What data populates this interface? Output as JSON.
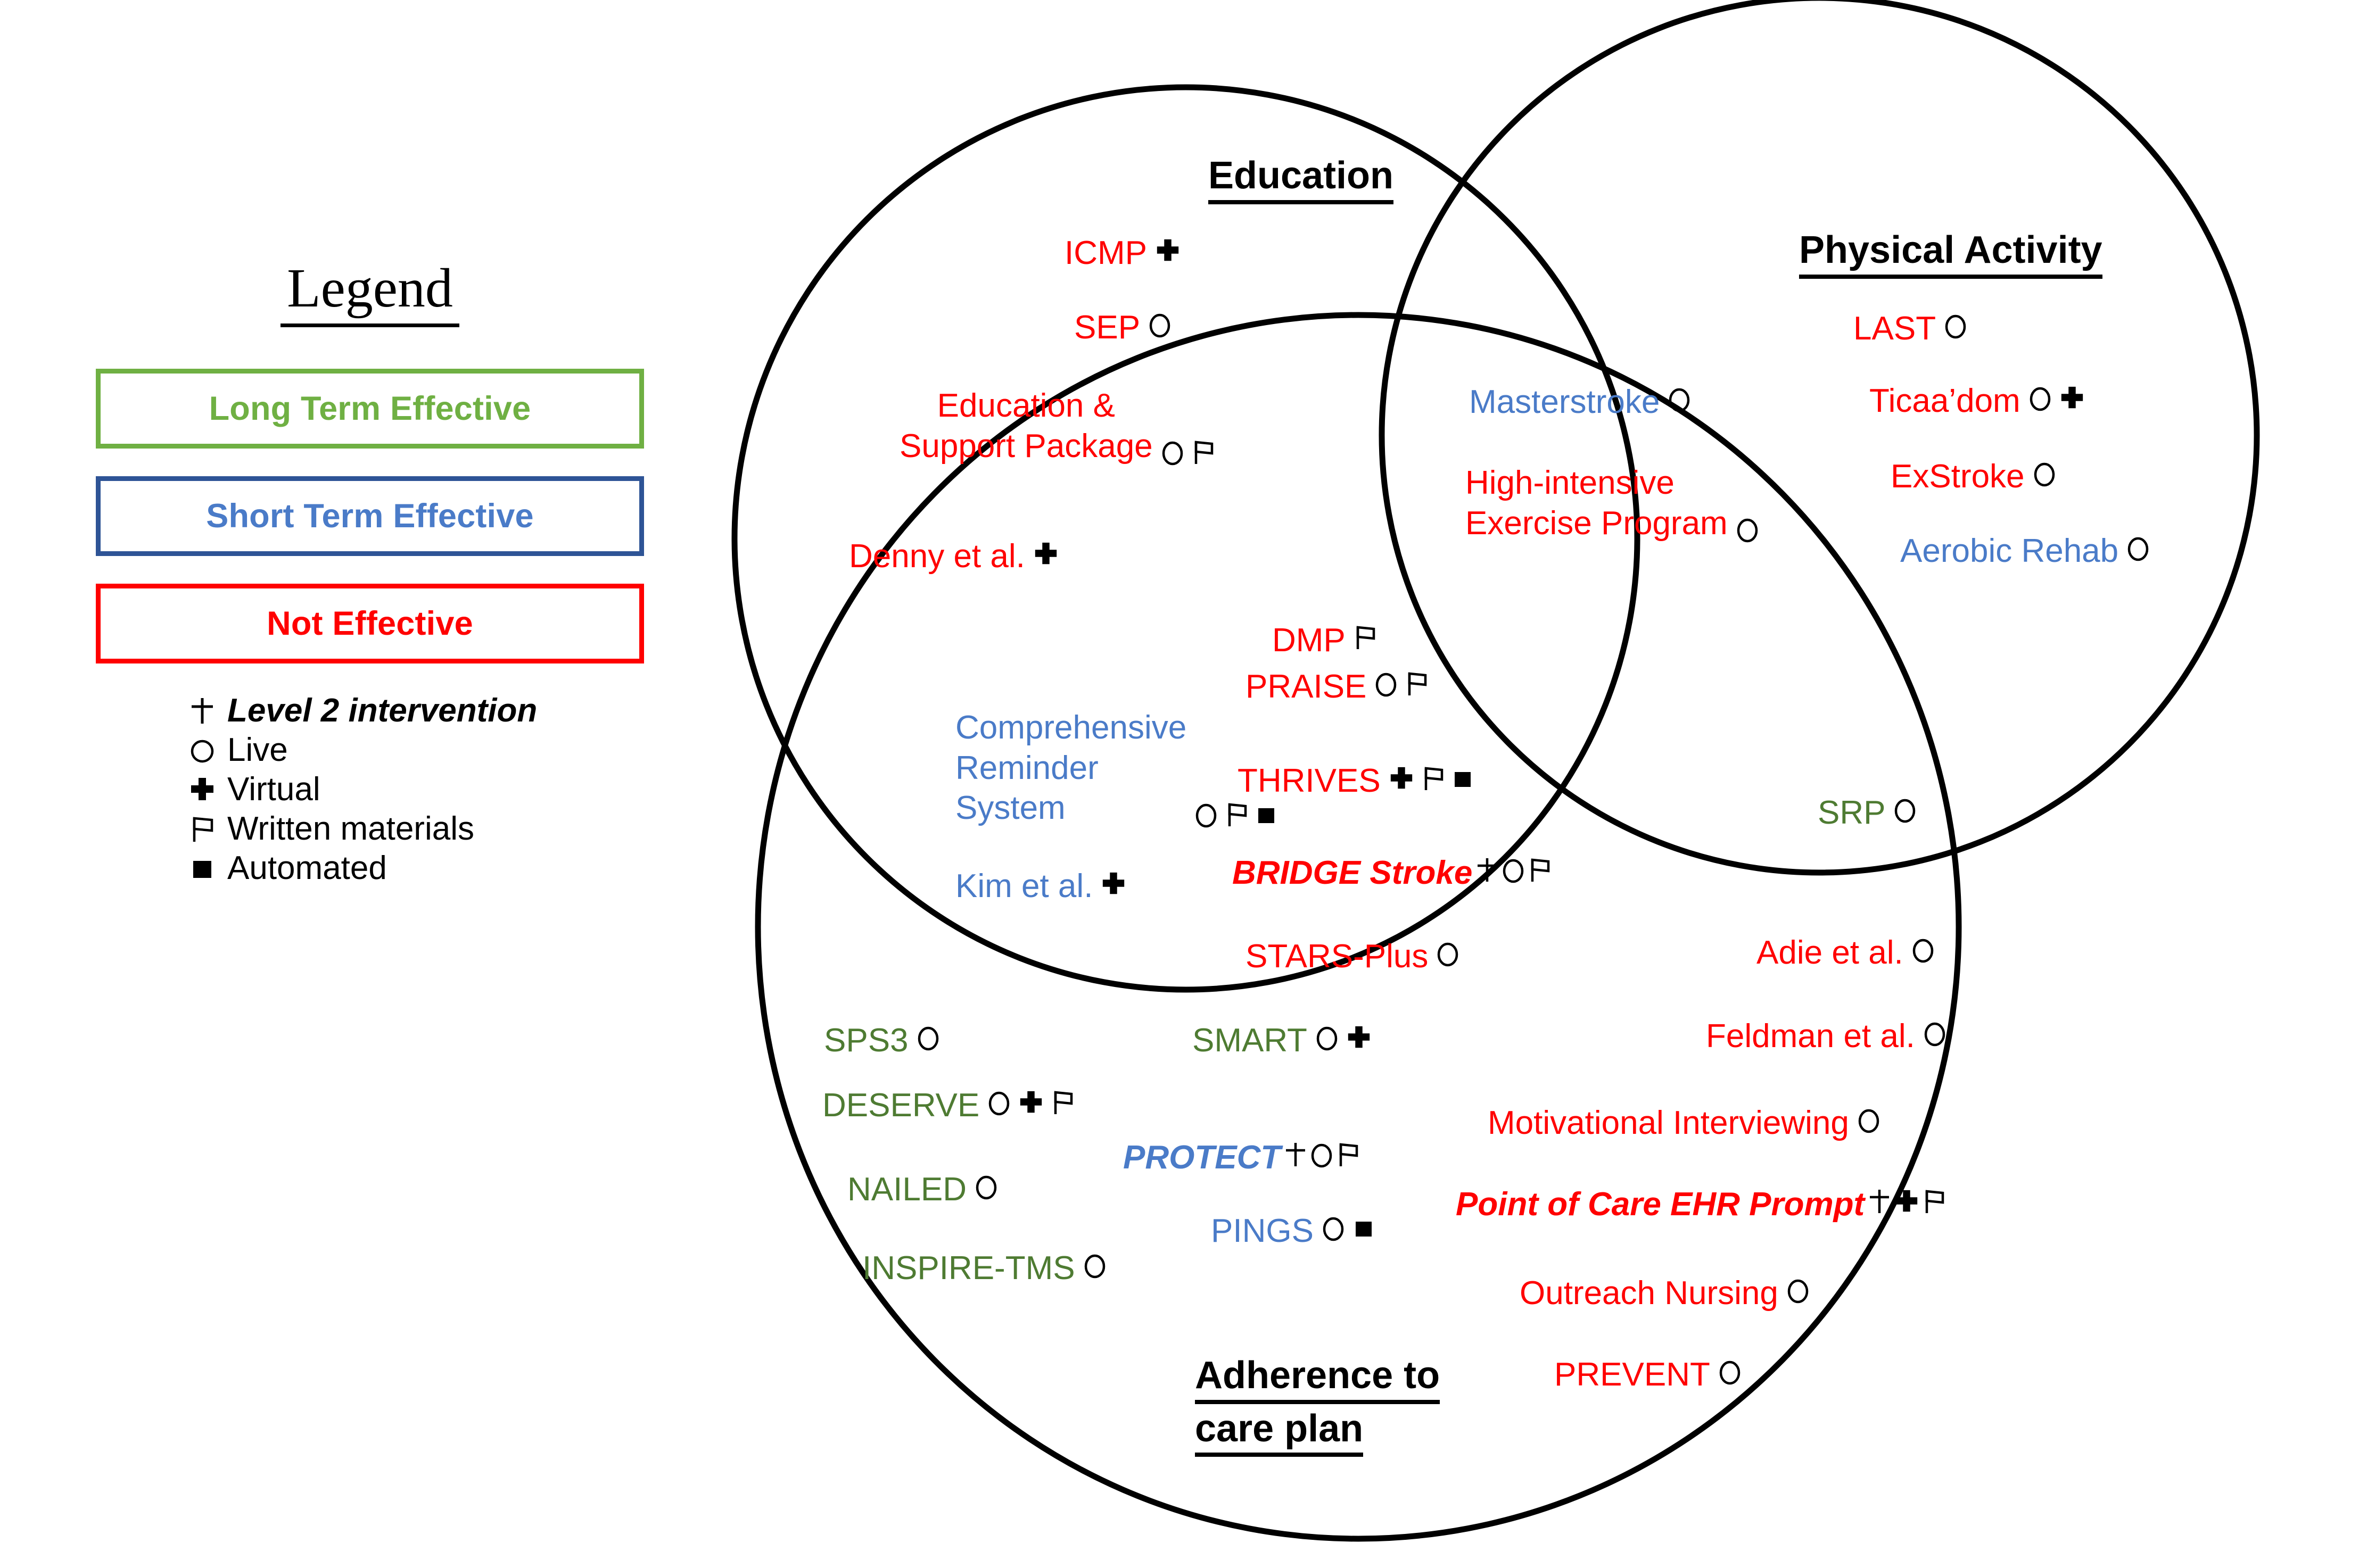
{
  "legend": {
    "title": "Legend",
    "categories": [
      {
        "id": "long",
        "label": "Long Term Effective",
        "color": "#6FB043"
      },
      {
        "id": "short",
        "label": "Short Term Effective",
        "color": "#4A7BC8"
      },
      {
        "id": "not",
        "label": "Not Effective",
        "color": "#FF0000"
      }
    ],
    "symbols": [
      {
        "icon": "thin-cross-icon",
        "label": "Level 2 intervention",
        "italic": true
      },
      {
        "icon": "hollow-circle-icon",
        "label": "Live",
        "italic": false
      },
      {
        "icon": "bold-plus-icon",
        "label": "Virtual",
        "italic": false
      },
      {
        "icon": "flag-icon",
        "label": "Written materials",
        "italic": false
      },
      {
        "icon": "filled-square-icon",
        "label": "Automated",
        "italic": false
      }
    ]
  },
  "venn": {
    "circles": [
      {
        "id": "education",
        "title": "Education"
      },
      {
        "id": "physical",
        "title": "Physical Activity"
      },
      {
        "id": "adherence",
        "title": "Adherence to\ncare plan"
      }
    ]
  },
  "chart_data": {
    "type": "venn",
    "title": "",
    "sets": [
      "Education",
      "Physical Activity",
      "Adherence to care plan"
    ],
    "effectiveness_legend": {
      "green": "Long Term Effective",
      "blue": "Short Term Effective",
      "red": "Not Effective"
    },
    "symbol_legend": {
      "thin-cross": "Level 2 intervention",
      "hollow-circle": "Live",
      "bold-plus": "Virtual",
      "flag": "Written materials",
      "filled-square": "Automated"
    },
    "regions": [
      {
        "region": "Education only",
        "items": [
          {
            "name": "ICMP",
            "effect": "not",
            "symbols": [
              "bold-plus"
            ]
          },
          {
            "name": "SEP",
            "effect": "not",
            "symbols": [
              "hollow-circle"
            ]
          },
          {
            "name": "Education &\nSupport Package",
            "effect": "not",
            "symbols": [
              "hollow-circle",
              "flag"
            ]
          },
          {
            "name": "Denny et al.",
            "effect": "not",
            "symbols": [
              "bold-plus"
            ]
          }
        ]
      },
      {
        "region": "Education ∩ Physical Activity",
        "items": [
          {
            "name": "Masterstroke",
            "effect": "short",
            "symbols": [
              "hollow-circle"
            ]
          },
          {
            "name": "High-intensive\nExercise Program",
            "effect": "not",
            "symbols": [
              "hollow-circle"
            ]
          }
        ]
      },
      {
        "region": "Physical Activity only",
        "items": [
          {
            "name": "LAST",
            "effect": "not",
            "symbols": [
              "hollow-circle"
            ]
          },
          {
            "name": "Ticaa’dom",
            "effect": "not",
            "symbols": [
              "hollow-circle",
              "bold-plus"
            ]
          },
          {
            "name": "ExStroke",
            "effect": "not",
            "symbols": [
              "hollow-circle"
            ]
          },
          {
            "name": "Aerobic Rehab",
            "effect": "short",
            "symbols": [
              "hollow-circle"
            ]
          }
        ]
      },
      {
        "region": "Education ∩ Adherence to care plan",
        "items": [
          {
            "name": "DMP",
            "effect": "not",
            "symbols": [
              "flag"
            ]
          },
          {
            "name": "PRAISE",
            "effect": "not",
            "symbols": [
              "hollow-circle",
              "flag"
            ]
          },
          {
            "name": "Comprehensive\nReminder\nSystem",
            "effect": "short",
            "symbols": [
              "hollow-circle",
              "flag",
              "filled-square"
            ]
          },
          {
            "name": "THRIVES",
            "effect": "not",
            "symbols": [
              "bold-plus",
              "flag",
              "filled-square"
            ]
          },
          {
            "name": "BRIDGE Stroke",
            "effect": "not",
            "italic": true,
            "symbols": [
              "thin-cross",
              "hollow-circle",
              "flag"
            ]
          },
          {
            "name": "Kim et al.",
            "effect": "short",
            "symbols": [
              "bold-plus"
            ]
          },
          {
            "name": "STARS-Plus",
            "effect": "not",
            "symbols": [
              "hollow-circle"
            ]
          },
          {
            "name": "SMART",
            "effect": "long",
            "symbols": [
              "hollow-circle",
              "bold-plus"
            ]
          }
        ]
      },
      {
        "region": "Physical Activity ∩ Adherence to care plan",
        "items": [
          {
            "name": "SRP",
            "effect": "long",
            "symbols": [
              "hollow-circle"
            ]
          }
        ]
      },
      {
        "region": "Adherence to care plan only",
        "items": [
          {
            "name": "SPS3",
            "effect": "long",
            "symbols": [
              "hollow-circle"
            ]
          },
          {
            "name": "DESERVE",
            "effect": "long",
            "symbols": [
              "hollow-circle",
              "bold-plus",
              "flag"
            ]
          },
          {
            "name": "NAILED",
            "effect": "long",
            "symbols": [
              "hollow-circle"
            ]
          },
          {
            "name": "INSPIRE-TMS",
            "effect": "long",
            "symbols": [
              "hollow-circle"
            ]
          },
          {
            "name": "PROTECT",
            "effect": "short",
            "italic": true,
            "symbols": [
              "thin-cross",
              "hollow-circle",
              "flag"
            ]
          },
          {
            "name": "PINGS",
            "effect": "short",
            "symbols": [
              "hollow-circle",
              "filled-square"
            ]
          },
          {
            "name": "Adie et al.",
            "effect": "not",
            "symbols": [
              "hollow-circle"
            ]
          },
          {
            "name": "Feldman et al.",
            "effect": "not",
            "symbols": [
              "hollow-circle"
            ]
          },
          {
            "name": "Motivational Interviewing",
            "effect": "not",
            "symbols": [
              "hollow-circle"
            ]
          },
          {
            "name": "Point of Care EHR Prompt",
            "effect": "not",
            "italic": true,
            "symbols": [
              "thin-cross",
              "bold-plus",
              "flag"
            ]
          },
          {
            "name": "Outreach Nursing",
            "effect": "not",
            "symbols": [
              "hollow-circle"
            ]
          },
          {
            "name": "PREVENT",
            "effect": "not",
            "symbols": [
              "hollow-circle"
            ]
          }
        ]
      }
    ]
  },
  "entries": {
    "icmp": {
      "label": "ICMP"
    },
    "sep": {
      "label": "SEP"
    },
    "edu_support": {
      "label": "Education &\nSupport Package"
    },
    "denny": {
      "label": "Denny et al."
    },
    "masterstroke": {
      "label": "Masterstroke"
    },
    "highintensive": {
      "label": "High-intensive\nExercise Program"
    },
    "last": {
      "label": "LAST"
    },
    "ticaadom": {
      "label": "Ticaa’dom"
    },
    "exstroke": {
      "label": "ExStroke"
    },
    "aerobic": {
      "label": "Aerobic Rehab"
    },
    "dmp": {
      "label": "DMP"
    },
    "praise": {
      "label": "PRAISE"
    },
    "crs": {
      "label": "Comprehensive\nReminder\nSystem"
    },
    "thrives": {
      "label": "THRIVES"
    },
    "bridge": {
      "label": "BRIDGE Stroke"
    },
    "kim": {
      "label": "Kim et al."
    },
    "starsplus": {
      "label": "STARS-Plus"
    },
    "smart": {
      "label": "SMART"
    },
    "srp": {
      "label": "SRP"
    },
    "sps3": {
      "label": "SPS3"
    },
    "deserve": {
      "label": "DESERVE"
    },
    "nailed": {
      "label": "NAILED"
    },
    "inspire": {
      "label": "INSPIRE-TMS"
    },
    "protect": {
      "label": "PROTECT"
    },
    "pings": {
      "label": "PINGS"
    },
    "adie": {
      "label": "Adie et al."
    },
    "feldman": {
      "label": "Feldman et al."
    },
    "motiv": {
      "label": "Motivational Interviewing"
    },
    "ehr": {
      "label": "Point of Care EHR Prompt"
    },
    "outreach": {
      "label": "Outreach Nursing"
    },
    "prevent": {
      "label": "PREVENT"
    }
  }
}
